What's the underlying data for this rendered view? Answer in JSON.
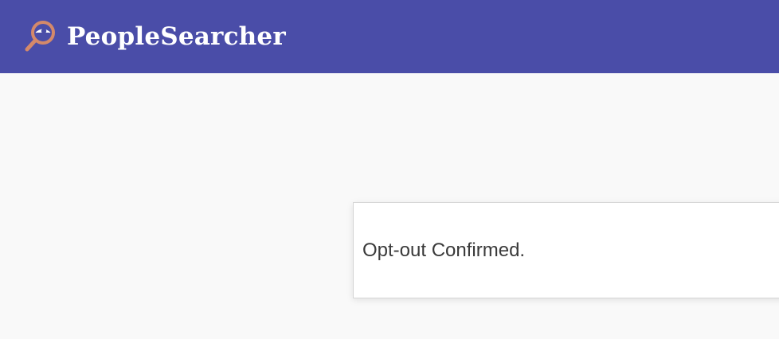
{
  "header": {
    "brand_name": "PeopleSearcher",
    "logo_icon": "magnifying-glass-eye-icon",
    "background_color": "#4a4da8",
    "icon_color": "#d4896a"
  },
  "main": {
    "confirmation_message": "Opt-out Confirmed."
  }
}
